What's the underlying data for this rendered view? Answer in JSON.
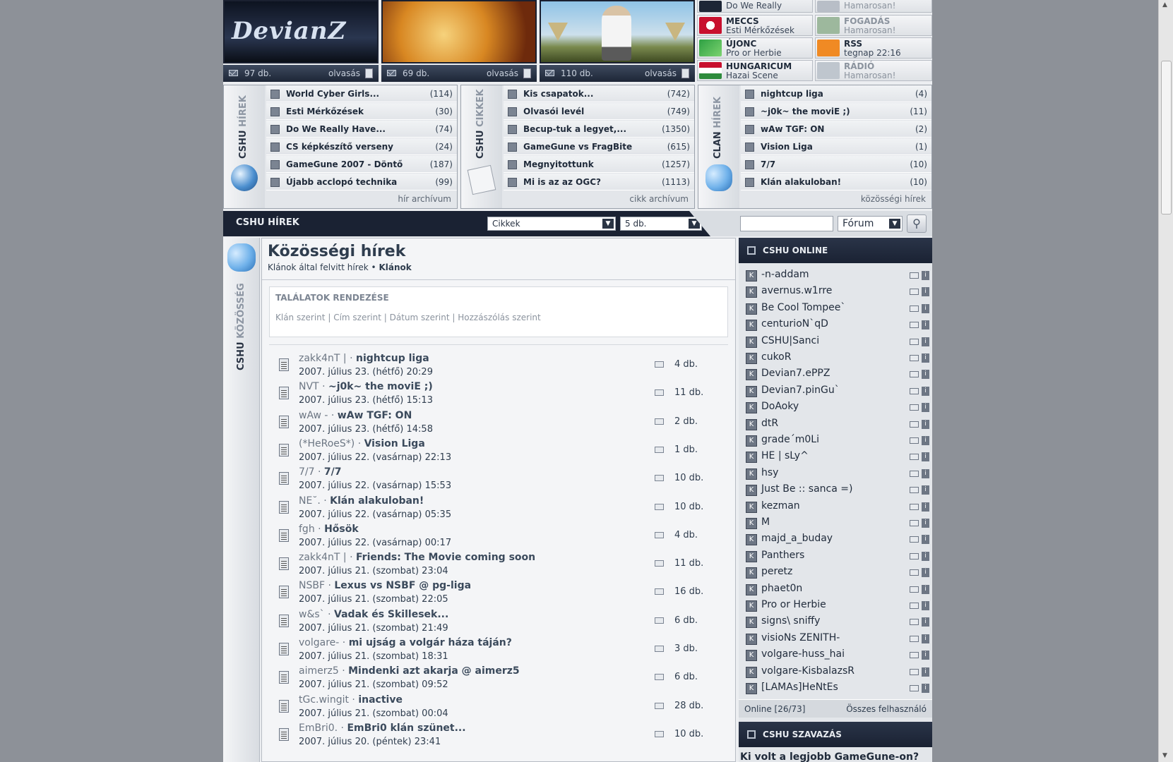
{
  "banners": [
    {
      "logo": "DevianZ",
      "count": "97 db.",
      "read": "olvasás"
    },
    {
      "count": "69 db.",
      "read": "olvasás"
    },
    {
      "count": "110 db.",
      "read": "olvasás"
    }
  ],
  "quicklinks": [
    {
      "title": "",
      "sub": "Do We Really"
    },
    {
      "title": "",
      "sub": "Hamarosan!"
    },
    {
      "title": "MECCS",
      "sub": "Esti Mérkőzések"
    },
    {
      "title": "FOGADÁS",
      "sub": "Hamarosan!"
    },
    {
      "title": "ÚJONC",
      "sub": "Pro or Herbie"
    },
    {
      "title": "RSS",
      "sub": "tegnap 22:16"
    },
    {
      "title": "HUNGARICUM",
      "sub": "Hazai Scene"
    },
    {
      "title": "RÁDIÓ",
      "sub": "Hamarosan!"
    }
  ],
  "sections": [
    {
      "label_a": "CSHU",
      "label_b": "HÍREK",
      "archive": "hír archívum",
      "items": [
        {
          "t": "World Cyber Girls...",
          "c": "(114)"
        },
        {
          "t": "Esti Mérkőzések",
          "c": "(30)"
        },
        {
          "t": "Do We Really Have...",
          "c": "(74)"
        },
        {
          "t": "CS képkészítő verseny",
          "c": "(24)"
        },
        {
          "t": "GameGune 2007 - Döntő",
          "c": "(187)"
        },
        {
          "t": "Újabb acclopó technika",
          "c": "(99)"
        }
      ]
    },
    {
      "label_a": "CSHU",
      "label_b": "CIKKEK",
      "archive": "cikk archívum",
      "items": [
        {
          "t": "Kis csapatok...",
          "c": "(742)"
        },
        {
          "t": "Olvasói levél",
          "c": "(749)"
        },
        {
          "t": "Becup-tuk a legyet,...",
          "c": "(1350)"
        },
        {
          "t": "GameGune vs FragBite",
          "c": "(615)"
        },
        {
          "t": "Megnyitottunk",
          "c": "(1257)"
        },
        {
          "t": "Mi is az az OGC?",
          "c": "(1113)"
        }
      ]
    },
    {
      "label_a": "CLAN",
      "label_b": "HÍREK",
      "archive": "közösségi hírek",
      "items": [
        {
          "t": "nightcup liga",
          "c": "(4)"
        },
        {
          "t": "~j0k~ the moviE ;)",
          "c": "(11)"
        },
        {
          "t": "wAw TGF: ON",
          "c": "(2)"
        },
        {
          "t": "Vision Liga",
          "c": "(1)"
        },
        {
          "t": "7/7",
          "c": "(10)"
        },
        {
          "t": "Klán alakuloban!",
          "c": "(10)"
        }
      ]
    }
  ],
  "navbar": {
    "title": "CSHU HÍREK",
    "select1": "Cikkek",
    "select2": "5 db.",
    "search_value": "",
    "forum_select": "Fórum"
  },
  "lefttab": {
    "a": "CSHU",
    "b": "KÖZÖSSÉG"
  },
  "content": {
    "title": "Közösségi hírek",
    "breadcrumb_text": "Klánok által felvitt hírek",
    "breadcrumb_sep": "•",
    "breadcrumb_link": "Klánok",
    "sort_title": "TALÁLATOK RENDEZÉSE",
    "sort_options": [
      "Klán szerint",
      "Cím szerint",
      "Dátum szerint",
      "Hozzászólás szerint"
    ],
    "sort_sep": "|",
    "items": [
      {
        "author": "zakk4nT |",
        "title": "nightcup liga",
        "date": "2007. július 23. (hétfő) 20:29",
        "count": "4 db."
      },
      {
        "author": "NVT",
        "title": "~j0k~ the moviE ;)",
        "date": "2007. július 23. (hétfő) 15:13",
        "count": "11 db."
      },
      {
        "author": "wAw -",
        "title": "wAw TGF: ON",
        "date": "2007. július 23. (hétfő) 14:58",
        "count": "2 db."
      },
      {
        "author": "(*HeRoeS*)",
        "title": "Vision Liga",
        "date": "2007. július 22. (vasárnap) 22:13",
        "count": "1 db."
      },
      {
        "author": "7/7",
        "title": "7/7",
        "date": "2007. július 22. (vasárnap) 15:53",
        "count": "10 db."
      },
      {
        "author": "NE˘.",
        "title": "Klán alakuloban!",
        "date": "2007. július 22. (vasárnap) 05:35",
        "count": "10 db."
      },
      {
        "author": "fgh",
        "title": "Hősök",
        "date": "2007. július 22. (vasárnap) 00:17",
        "count": "4 db."
      },
      {
        "author": "zakk4nT |",
        "title": "Friends: The Movie coming soon",
        "date": "2007. július 21. (szombat) 23:04",
        "count": "11 db."
      },
      {
        "author": "NSBF",
        "title": "Lexus vs NSBF @ pg-liga",
        "date": "2007. július 21. (szombat) 22:05",
        "count": "16 db."
      },
      {
        "author": "w&s`",
        "title": "Vadak és Skillesek...",
        "date": "2007. július 21. (szombat) 21:49",
        "count": "6 db."
      },
      {
        "author": "volgare-",
        "title": "mi ujság a volgár háza táján?",
        "date": "2007. július 21. (szombat) 18:31",
        "count": "3 db."
      },
      {
        "author": "aimerz5",
        "title": "Mindenki azt akarja @ aimerz5",
        "date": "2007. július 21. (szombat) 09:52",
        "count": "6 db."
      },
      {
        "author": "tGc.wingit",
        "title": "inactive",
        "date": "2007. július 21. (szombat) 00:04",
        "count": "28 db."
      },
      {
        "author": "EmBri0.",
        "title": "EmBri0 klán szünet...",
        "date": "2007. július 20. (péntek) 23:41",
        "count": "10 db."
      }
    ]
  },
  "online": {
    "title": "CSHU ONLINE",
    "users": [
      "-n-addam",
      "avernus.w1rre",
      "Be Cool Tompee`",
      "centurioN`qD",
      "CSHU|Sanci",
      "cukoR",
      "Devian7.ePPZ",
      "Devian7.pinGu`",
      "DoAoky",
      "dtR",
      "grade´m0Li",
      "HE | sLy^",
      "hsy",
      "Just Be :: sanca =)",
      "kezman",
      "M",
      "majd_a_buday",
      "Panthers",
      "peretz",
      "phaet0n",
      "Pro or Herbie",
      "signs\\ sniffy",
      "visioNs ZENITH-",
      "volgare-huss_hai",
      "volgare-KisbalazsR",
      "[LAMAs]HeNtEs"
    ],
    "footer_count": "Online [26/73]",
    "footer_all": "Összes felhasználó"
  },
  "poll": {
    "title": "CSHU SZAVAZÁS",
    "question": "Ki volt a legjobb GameGune-on?"
  }
}
